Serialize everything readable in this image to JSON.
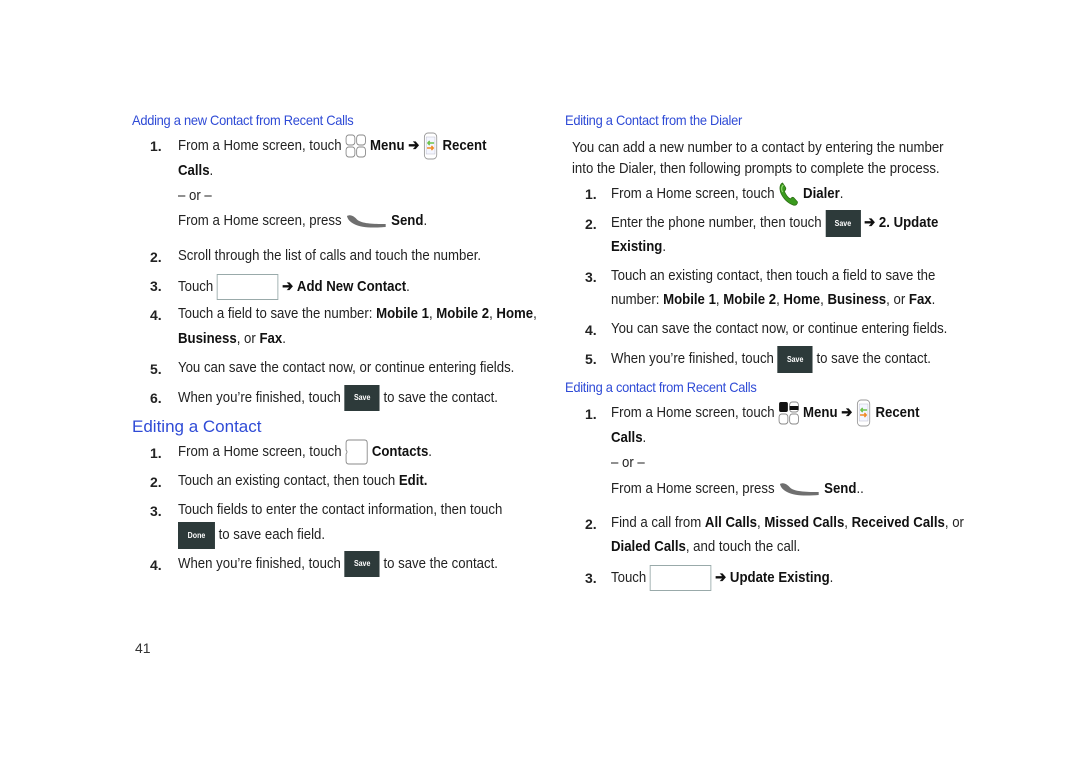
{
  "left": {
    "section1": {
      "title": "Adding a new Contact from Recent Calls",
      "steps": [
        {
          "num": "1.",
          "pre": "From a Home screen, touch",
          "b1": "Menu",
          "arrow": "➔",
          "b2": "Recent",
          "b3": "Calls",
          "end": "."
        },
        {
          "or": "– or –"
        },
        {
          "pre": "From a Home screen, press",
          "b1": "Send",
          "end": "."
        },
        {
          "num": "2.",
          "text": "Scroll through the list of calls and touch the number."
        },
        {
          "num": "3.",
          "pre": "Touch",
          "arrow": "➔",
          "b1": "Add New Contact",
          "end": "."
        },
        {
          "num": "4.",
          "pre": "Touch a field to save the number:",
          "b1": "Mobile 1",
          "b2": "Mobile 2",
          "b3": "Home",
          "b4": "Business",
          "or_word": "or",
          "b5": "Fax",
          "end": "."
        },
        {
          "num": "5.",
          "text": "You can save the contact now, or continue entering fields."
        },
        {
          "num": "6.",
          "pre": "When you’re finished, touch",
          "button": "Save",
          "post": "to save the contact."
        }
      ]
    },
    "section2": {
      "title": "Editing a Contact",
      "steps": [
        {
          "num": "1.",
          "pre": "From a Home screen, touch",
          "b1": "Contacts",
          "end": "."
        },
        {
          "num": "2.",
          "pre": "Touch an existing contact, then touch",
          "b1": "Edit."
        },
        {
          "num": "3.",
          "text": "Touch fields to enter the contact information, then touch",
          "button": "Done",
          "post": "to save each field."
        },
        {
          "num": "4.",
          "pre": "When you’re finished, touch",
          "button": "Save",
          "post": "to save the contact."
        }
      ]
    }
  },
  "right": {
    "section1": {
      "title": "Editing a Contact from the Dialer",
      "intro1": "You can add a new number to a contact by entering the number",
      "intro2": "into the Dialer, then following prompts to complete the process.",
      "steps": [
        {
          "num": "1.",
          "pre": "From a Home screen, touch",
          "b1": "Dialer",
          "end": "."
        },
        {
          "num": "2.",
          "pre": "Enter the phone number, then touch",
          "button": "Save",
          "arrow": "➔",
          "b1": "2. Update",
          "b2": "Existing",
          "end": "."
        },
        {
          "num": "3.",
          "text": "Touch an existing contact, then touch a field to save the",
          "pre2": "number:",
          "b1": "Mobile 1",
          "b2": "Mobile 2",
          "b3": "Home",
          "b4": "Business",
          "or_word": "or",
          "b5": "Fax",
          "end": "."
        },
        {
          "num": "4.",
          "text": "You can save the contact now, or continue entering fields."
        },
        {
          "num": "5.",
          "pre": "When you’re finished, touch",
          "button": "Save",
          "post": "to save the contact."
        }
      ]
    },
    "section2": {
      "title": "Editing a contact from Recent Calls",
      "steps": [
        {
          "num": "1.",
          "pre": "From a Home screen, touch",
          "b1": "Menu",
          "arrow": "➔",
          "b2": "Recent",
          "b3": "Calls",
          "end": "."
        },
        {
          "or": "– or –"
        },
        {
          "pre": "From a Home screen, press",
          "b1": "Send",
          "end": ".."
        },
        {
          "num": "2.",
          "pre": "Find a call from",
          "b1": "All Calls",
          "b2": "Missed Calls",
          "b3": "Received Calls",
          "or_word": "or",
          "b4": "Dialed Calls",
          "post": "and touch the call."
        },
        {
          "num": "3.",
          "pre": "Touch",
          "arrow": "➔",
          "b1": "Update Existing",
          "end": "."
        }
      ]
    }
  },
  "page_number": "41",
  "colors": {
    "heading": "#2f4bd6",
    "button": "#2d3a3a",
    "dialer_green": "#3a9a1e"
  }
}
